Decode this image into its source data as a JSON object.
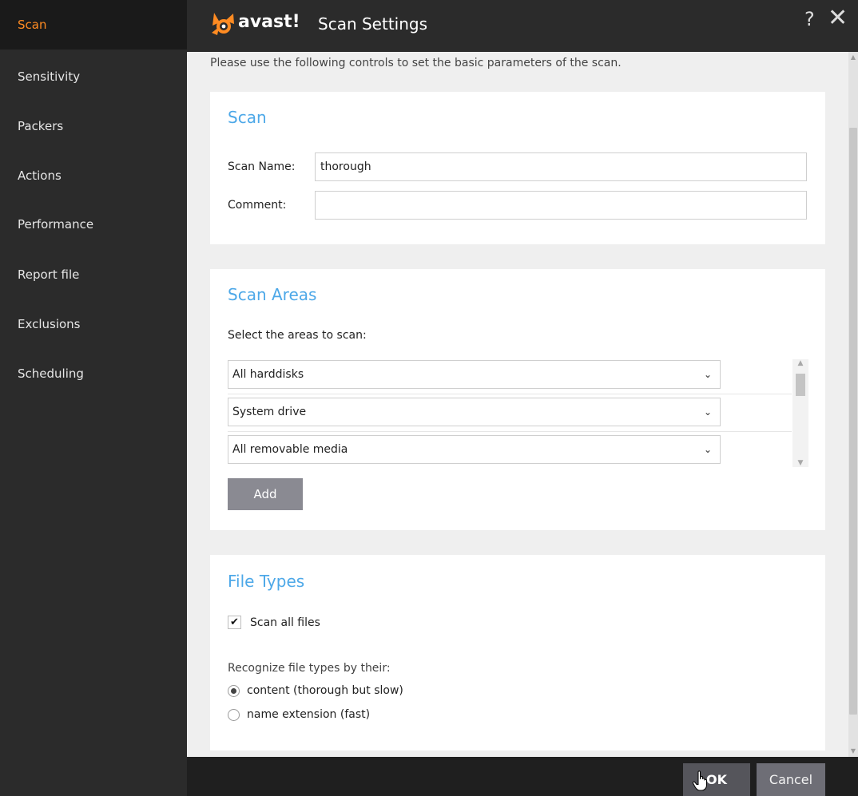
{
  "sidebar": {
    "items": [
      {
        "label": "Scan",
        "active": true
      },
      {
        "label": "Sensitivity"
      },
      {
        "label": "Packers"
      },
      {
        "label": "Actions"
      },
      {
        "label": "Performance"
      },
      {
        "label": "Report file"
      },
      {
        "label": "Exclusions"
      },
      {
        "label": "Scheduling"
      }
    ]
  },
  "header": {
    "brand": "avast!",
    "title": "Scan Settings",
    "help_label": "?",
    "close_label": "✕",
    "icons": [
      "avast-logo-icon",
      "help-icon",
      "close-icon"
    ]
  },
  "main": {
    "intro": "Please use the following controls to set the basic parameters of the scan.",
    "scan_section": {
      "title": "Scan",
      "scan_name_label": "Scan Name:",
      "scan_name_value": "thorough",
      "comment_label": "Comment:",
      "comment_value": ""
    },
    "areas_section": {
      "title": "Scan Areas",
      "subtitle": "Select the areas to scan:",
      "areas": [
        "All harddisks",
        "System drive",
        "All removable media"
      ],
      "add_label": "Add"
    },
    "file_types_section": {
      "title": "File Types",
      "scan_all_label": "Scan all files",
      "scan_all_checked": true,
      "recognize_label": "Recognize file types by their:",
      "options": [
        {
          "label": "content (thorough but slow)",
          "selected": true
        },
        {
          "label": "name extension (fast)",
          "selected": false
        }
      ]
    }
  },
  "footer": {
    "ok_label": "OK",
    "cancel_label": "Cancel"
  },
  "colors": {
    "accent_orange": "#ff8b22",
    "section_title_blue": "#4da8e8",
    "sidebar_bg": "#2b2b2b",
    "content_bg": "#efefef",
    "button_gray": "#8a8a92"
  }
}
